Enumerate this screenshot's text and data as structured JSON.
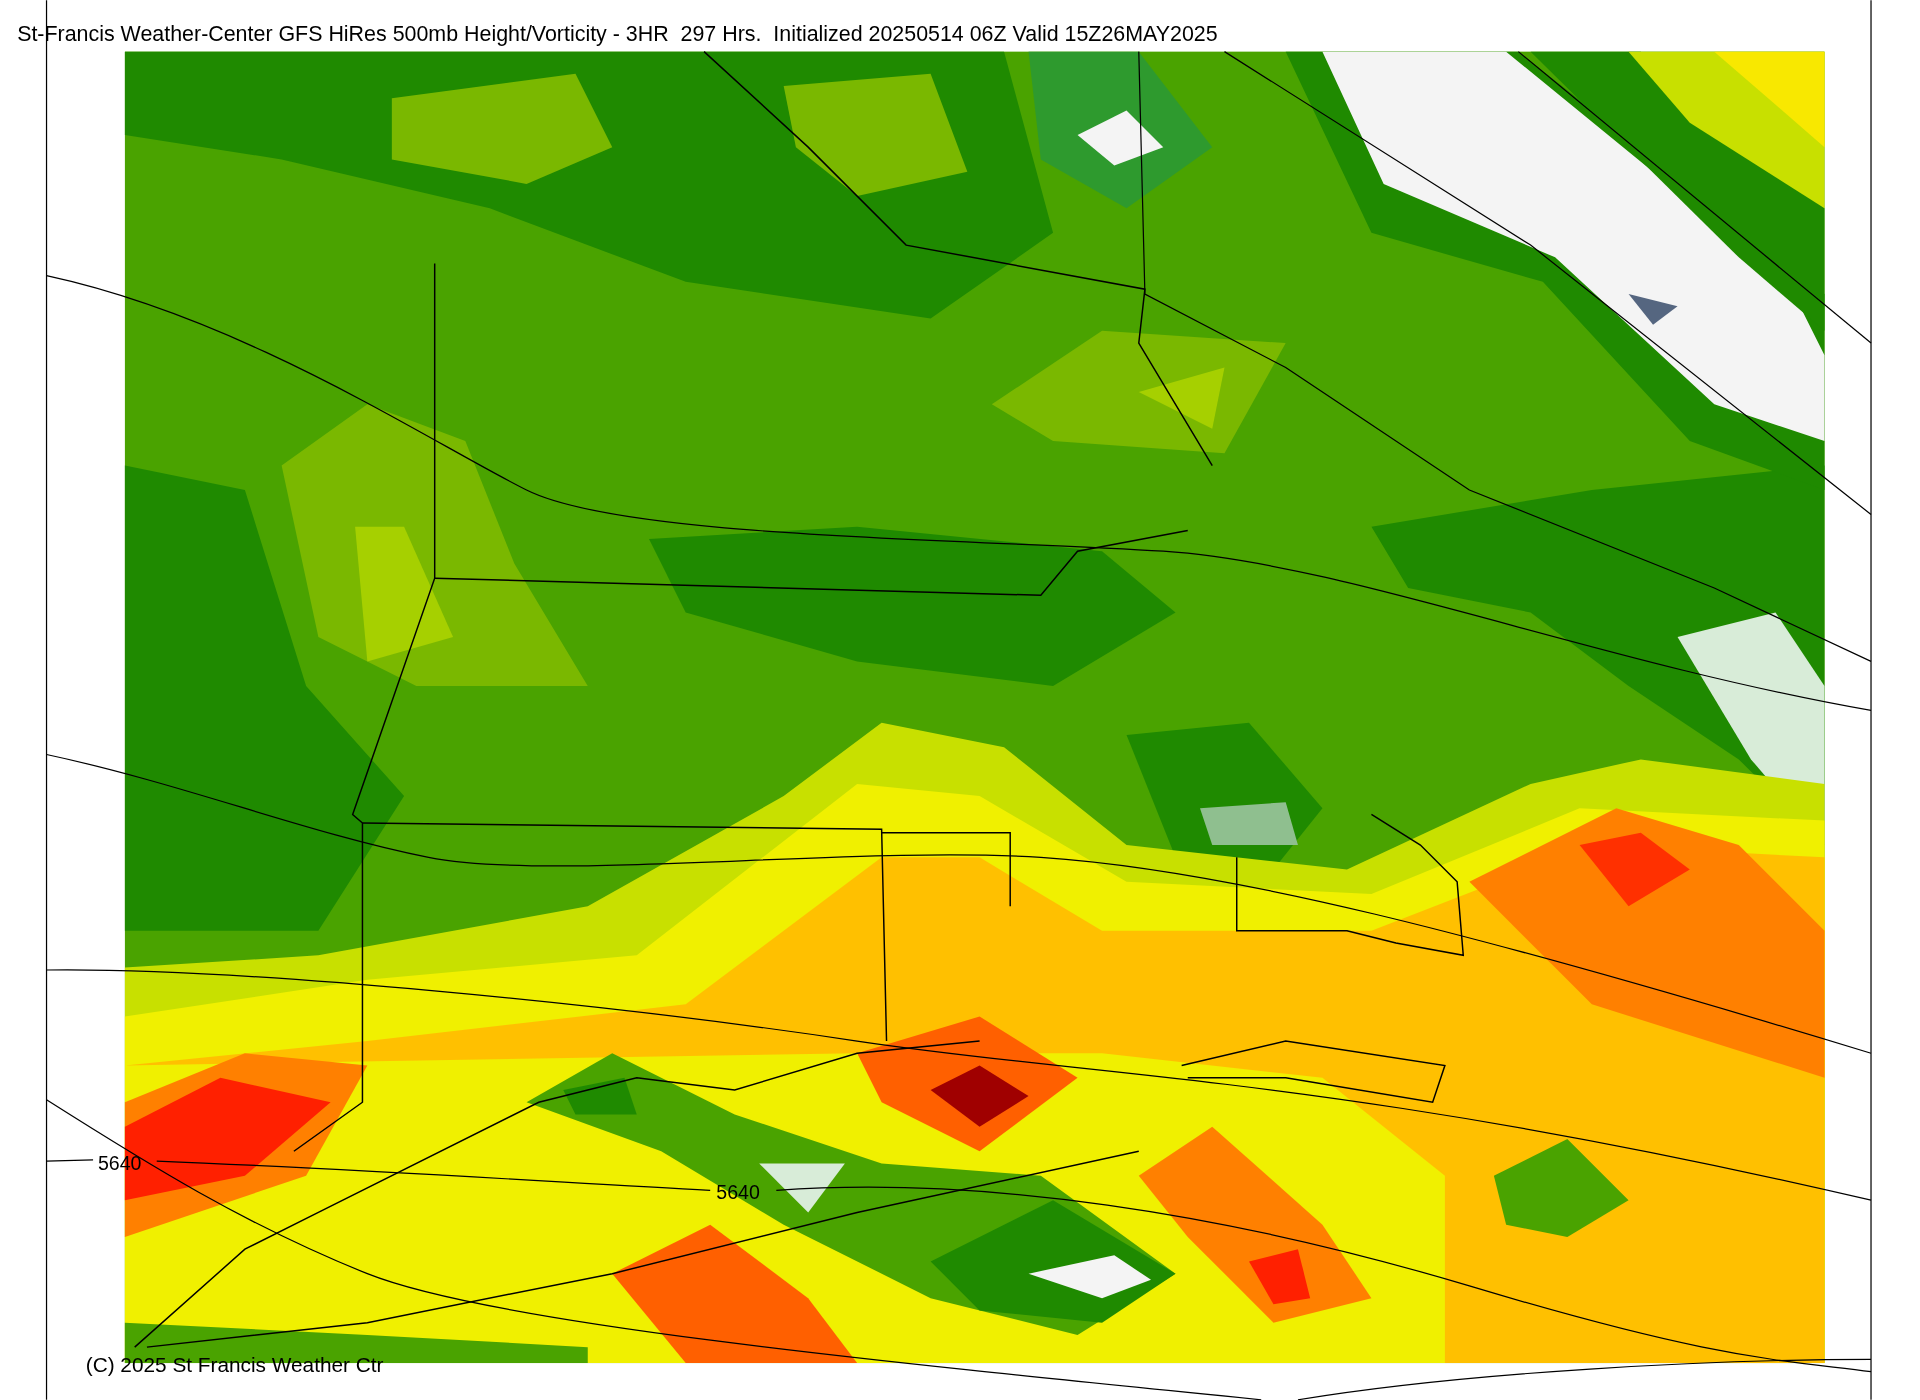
{
  "title": "St-Francis Weather-Center GFS HiRes 500mb Height/Vorticity - 3HR  297 Hrs.  Initialized 20250514 06Z Valid 15Z26MAY2025",
  "contour_labels": [
    "5640",
    "5640"
  ],
  "copyright": "(C) 2025 St Francis Weather Ctr"
}
